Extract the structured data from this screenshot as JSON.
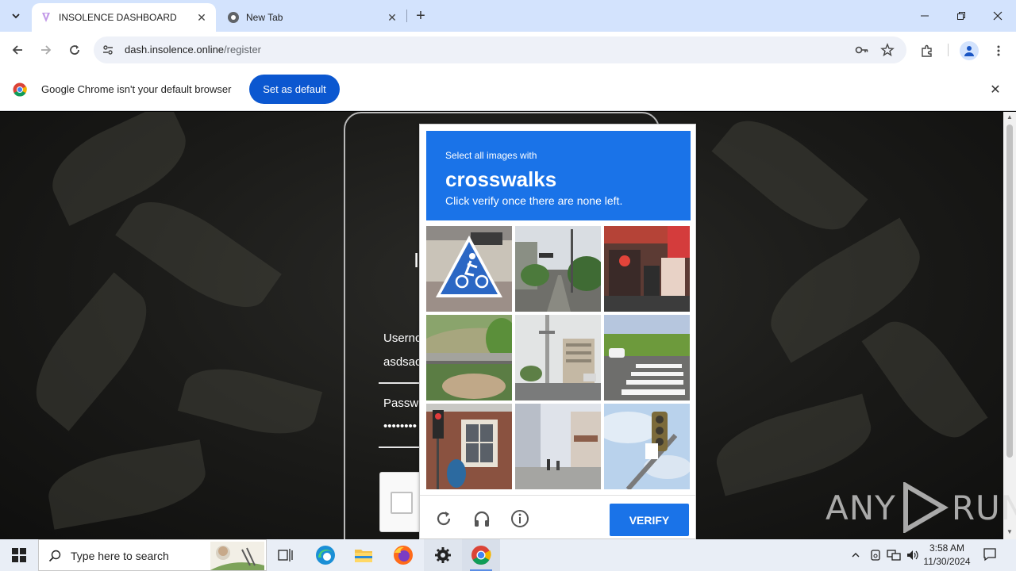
{
  "browser": {
    "tabs": [
      {
        "title": "INSOLENCE DASHBOARD",
        "active": true
      },
      {
        "title": "New Tab",
        "active": false
      }
    ],
    "url_host": "dash.insolence.online",
    "url_path": "/register"
  },
  "infobar": {
    "message": "Google Chrome isn't your default browser",
    "button": "Set as default"
  },
  "login": {
    "title": "I",
    "username_label": "Usernc",
    "username_value": "asdsac",
    "password_label": "Passw",
    "password_value": "••••••••"
  },
  "captcha": {
    "instruction_top": "Select all images with",
    "keyword": "crosswalks",
    "instruction_bottom": "Click verify once there are none left.",
    "verify_label": "VERIFY",
    "tiles": [
      {
        "name": "tile-bicycle-crossing-sign"
      },
      {
        "name": "tile-street-intersection"
      },
      {
        "name": "tile-shopping-street"
      },
      {
        "name": "tile-bridge-hillside"
      },
      {
        "name": "tile-power-poles-street"
      },
      {
        "name": "tile-zebra-crosswalk"
      },
      {
        "name": "tile-traffic-light-building"
      },
      {
        "name": "tile-pedestrian-street"
      },
      {
        "name": "tile-traffic-signal-sky"
      }
    ]
  },
  "watermark": {
    "left": "ANY",
    "right": "RUN"
  },
  "taskbar": {
    "search_placeholder": "Type here to search",
    "time": "3:58 AM",
    "date": "11/30/2024"
  },
  "colors": {
    "captcha_blue": "#1a73e8",
    "chrome_blue": "#0b57d0",
    "tabstrip": "#d3e3fd"
  }
}
